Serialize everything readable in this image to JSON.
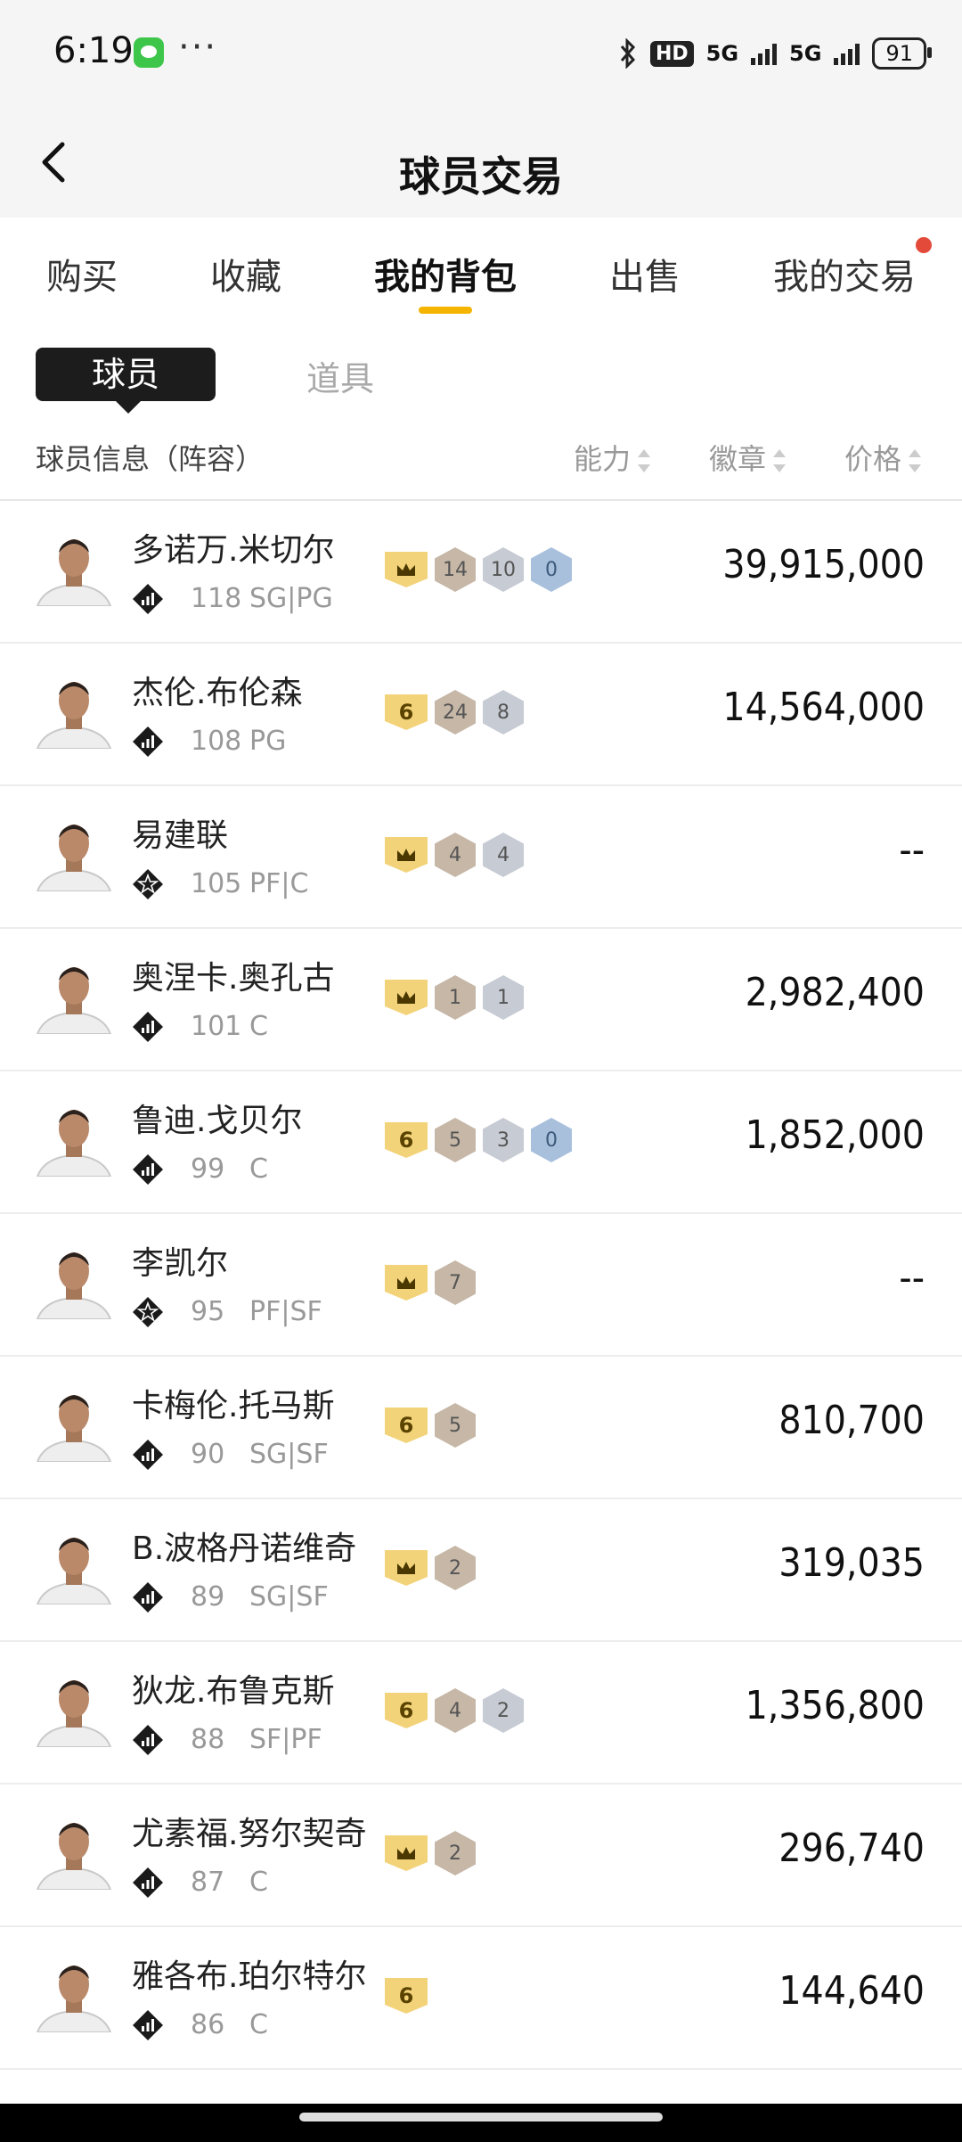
{
  "status": {
    "time": "6:19",
    "dots": "···",
    "hd": "HD",
    "net1": "5G",
    "net2": "5G",
    "battery": "91"
  },
  "nav": {
    "title": "球员交易"
  },
  "tabs": [
    {
      "label": "购买",
      "active": false
    },
    {
      "label": "收藏",
      "active": false
    },
    {
      "label": "我的背包",
      "active": true
    },
    {
      "label": "出售",
      "active": false
    },
    {
      "label": "我的交易",
      "active": false,
      "notification_dot": true
    }
  ],
  "subtabs": {
    "player": "球员",
    "items": "道具"
  },
  "list_header": {
    "info": "球员信息（阵容）",
    "ability": "能力",
    "badge": "徽章",
    "price": "价格"
  },
  "colors": {
    "accent": "#f5b400",
    "badge_gold": "#f3d37a",
    "dot": "#e34a3a"
  },
  "players": [
    {
      "name": "多诺万.米切尔",
      "ovr": "118",
      "pos": "SG|PG",
      "icon": "bars-rating-icon",
      "crown": true,
      "tier": "",
      "hex": [
        [
          "14",
          "bronze"
        ],
        [
          "10",
          "silver"
        ],
        [
          "0",
          "blue"
        ]
      ],
      "price": "39,915,000"
    },
    {
      "name": "杰伦.布伦森",
      "ovr": "108",
      "pos": "PG",
      "icon": "bars-rating-icon",
      "crown": false,
      "tier": "6",
      "hex": [
        [
          "24",
          "bronze"
        ],
        [
          "8",
          "silver"
        ]
      ],
      "price": "14,564,000"
    },
    {
      "name": "易建联",
      "ovr": "105",
      "pos": "PF|C",
      "icon": "star-rating-icon",
      "crown": true,
      "tier": "",
      "hex": [
        [
          "4",
          "bronze"
        ],
        [
          "4",
          "silver"
        ]
      ],
      "price": "--"
    },
    {
      "name": "奥涅卡.奥孔古",
      "ovr": "101",
      "pos": "C",
      "icon": "bars-rating-icon",
      "crown": true,
      "tier": "",
      "hex": [
        [
          "1",
          "bronze"
        ],
        [
          "1",
          "silver"
        ]
      ],
      "price": "2,982,400"
    },
    {
      "name": "鲁迪.戈贝尔",
      "ovr": "99",
      "pos": "C",
      "icon": "bars-rating-icon",
      "crown": false,
      "tier": "6",
      "hex": [
        [
          "5",
          "bronze"
        ],
        [
          "3",
          "silver"
        ],
        [
          "0",
          "blue"
        ]
      ],
      "price": "1,852,000"
    },
    {
      "name": "李凯尔",
      "ovr": "95",
      "pos": "PF|SF",
      "icon": "star-rating-icon",
      "crown": true,
      "tier": "",
      "hex": [
        [
          "7",
          "bronze"
        ]
      ],
      "price": "--"
    },
    {
      "name": "卡梅伦.托马斯",
      "ovr": "90",
      "pos": "SG|SF",
      "icon": "bars-rating-icon",
      "crown": false,
      "tier": "6",
      "hex": [
        [
          "5",
          "bronze"
        ]
      ],
      "price": "810,700"
    },
    {
      "name": "B.波格丹诺维奇",
      "ovr": "89",
      "pos": "SG|SF",
      "icon": "bars-rating-icon",
      "crown": true,
      "tier": "",
      "hex": [
        [
          "2",
          "bronze"
        ]
      ],
      "price": "319,035"
    },
    {
      "name": "狄龙.布鲁克斯",
      "ovr": "88",
      "pos": "SF|PF",
      "icon": "bars-rating-icon",
      "crown": false,
      "tier": "6",
      "hex": [
        [
          "4",
          "bronze"
        ],
        [
          "2",
          "silver"
        ]
      ],
      "price": "1,356,800"
    },
    {
      "name": "尤素福.努尔契奇",
      "ovr": "87",
      "pos": "C",
      "icon": "bars-rating-icon",
      "crown": true,
      "tier": "",
      "hex": [
        [
          "2",
          "bronze"
        ]
      ],
      "price": "296,740"
    },
    {
      "name": "雅各布.珀尔特尔",
      "ovr": "86",
      "pos": "C",
      "icon": "bars-rating-icon",
      "crown": false,
      "tier": "6",
      "hex": [],
      "price": "144,640"
    }
  ]
}
